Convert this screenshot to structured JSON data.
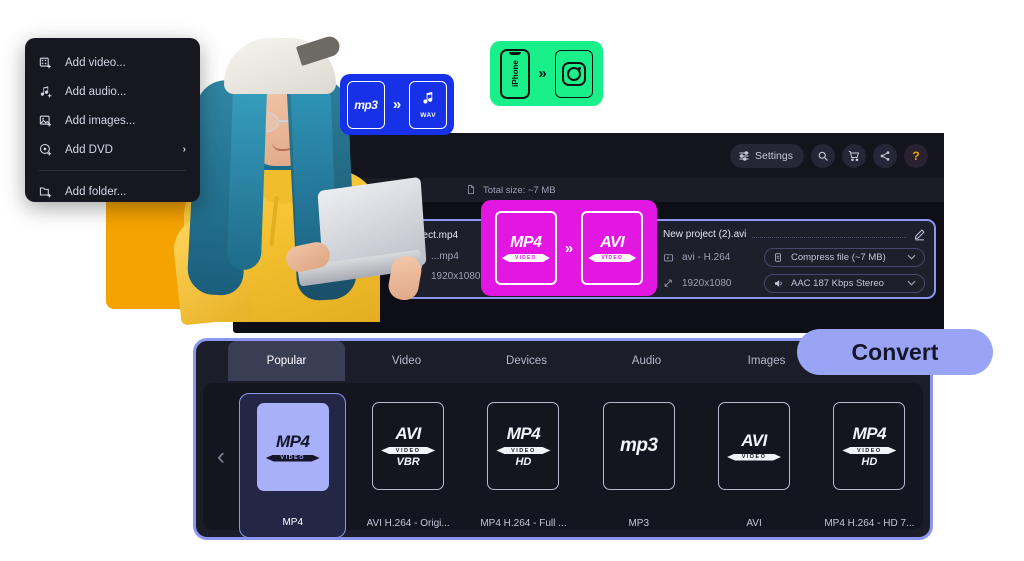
{
  "context_menu": {
    "items": [
      {
        "label": "Add video...",
        "icon": "add-video-icon",
        "has_submenu": false
      },
      {
        "label": "Add audio...",
        "icon": "add-audio-icon",
        "has_submenu": false
      },
      {
        "label": "Add images...",
        "icon": "add-images-icon",
        "has_submenu": false
      },
      {
        "label": "Add DVD",
        "icon": "add-dvd-icon",
        "has_submenu": true,
        "arrow": "›"
      },
      {
        "label": "Add folder...",
        "icon": "add-folder-icon",
        "has_submenu": false
      }
    ]
  },
  "app": {
    "toolbar": {
      "settings_label": "Settings",
      "settings_icon": "sliders-icon",
      "search_icon": "search-icon",
      "cart_icon": "cart-icon",
      "share_icon": "share-icon",
      "help_icon": "help-icon",
      "help_glyph": "?"
    },
    "subbar": {
      "total_size_label": "Total size: ~7 MB",
      "file_icon": "file-icon"
    },
    "file_row": {
      "source": {
        "name": "...ject.mp4",
        "format": "...mp4",
        "resolution": "1920x1080",
        "format_icon": "video-file-icon",
        "resolution_icon": "resize-icon"
      },
      "output": {
        "name": "New project (2).avi",
        "edit_icon": "pencil-icon",
        "format": "avi - H.264",
        "format_icon": "video-file-icon",
        "resolution": "1920x1080",
        "resolution_icon": "resize-icon",
        "compress_label": "Compress file (~7 MB)",
        "compress_icon": "compress-icon",
        "audio_label": "AAC 187 Kbps Stereo",
        "audio_icon": "speaker-icon",
        "caret": "⌄"
      }
    },
    "formats": {
      "tabs": [
        {
          "label": "Popular",
          "active": true
        },
        {
          "label": "Video",
          "active": false
        },
        {
          "label": "Devices",
          "active": false
        },
        {
          "label": "Audio",
          "active": false
        },
        {
          "label": "Images",
          "active": false
        }
      ],
      "prev_arrow": "‹",
      "cards": [
        {
          "label": "MP4",
          "glyph": "MP4",
          "ribbon": "VIDEO",
          "ext": "",
          "selected": true
        },
        {
          "label": "AVI H.264 - Origi...",
          "glyph": "AVI",
          "ribbon": "VIDEO",
          "ext": "VBR",
          "selected": false
        },
        {
          "label": "MP4 H.264 - Full ...",
          "glyph": "MP4",
          "ribbon": "VIDEO",
          "ext": "HD",
          "selected": false
        },
        {
          "label": "MP3",
          "glyph": "mp3",
          "ribbon": "",
          "ext": "",
          "selected": false
        },
        {
          "label": "AVI",
          "glyph": "AVI",
          "ribbon": "VIDEO",
          "ext": "",
          "selected": false
        },
        {
          "label": "MP4 H.264 - HD 7...",
          "glyph": "MP4",
          "ribbon": "VIDEO",
          "ext": "HD",
          "selected": false
        }
      ]
    },
    "convert_button": "Convert"
  },
  "badges": {
    "audio": {
      "from": "mp3",
      "arrow": "»",
      "to": "WAV",
      "to_icon": "music-note-icon",
      "color": "#1631E8"
    },
    "device": {
      "from": "iPhone",
      "from_icon": "iphone-icon",
      "arrow": "»",
      "to_icon": "instagram-icon",
      "color": "#19F08A"
    },
    "video": {
      "from": "MP4",
      "from_ribbon": "VIDEO",
      "arrow": "»",
      "to": "AVI",
      "to_ribbon": "VIDEO",
      "color": "#E217E2"
    }
  },
  "decor": {
    "orange_block_color": "#F5A300",
    "accent_color": "#8c96f0",
    "photo_alt": "woman-with-blue-hair-using-laptop"
  }
}
